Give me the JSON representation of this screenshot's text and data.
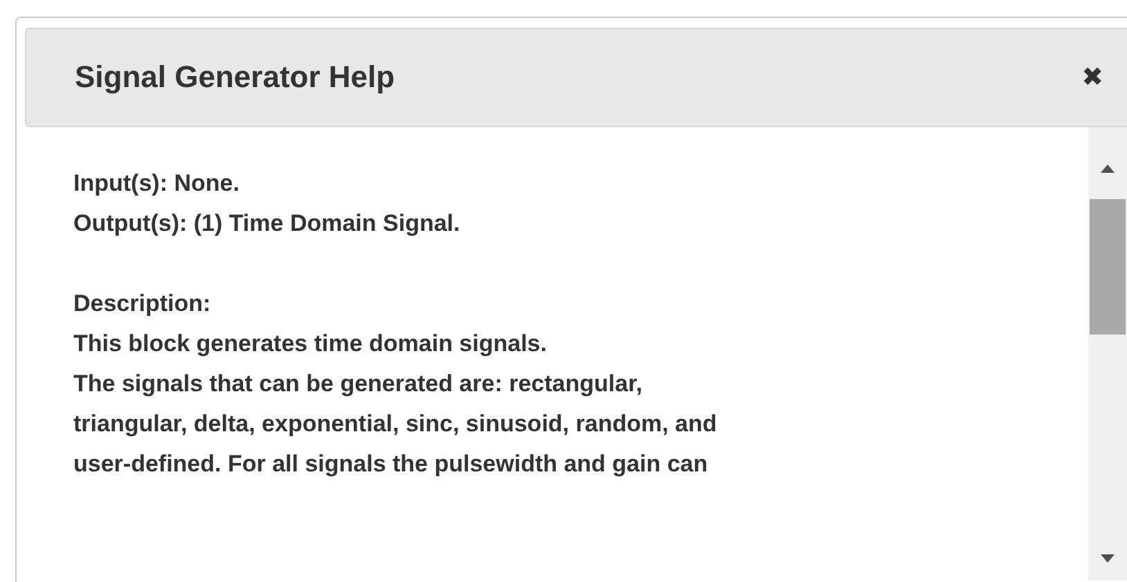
{
  "dialog": {
    "title": "Signal Generator Help",
    "close": "✖",
    "paragraphs": [
      [
        "Input(s): None.",
        "Output(s): (1) Time Domain Signal."
      ],
      [
        "Description:",
        "This block generates time domain signals.",
        "The signals that can be generated are: rectangular,",
        "triangular, delta, exponential, sinc, sinusoid, random, and",
        "user-defined. For all signals the pulsewidth and gain can"
      ]
    ]
  }
}
